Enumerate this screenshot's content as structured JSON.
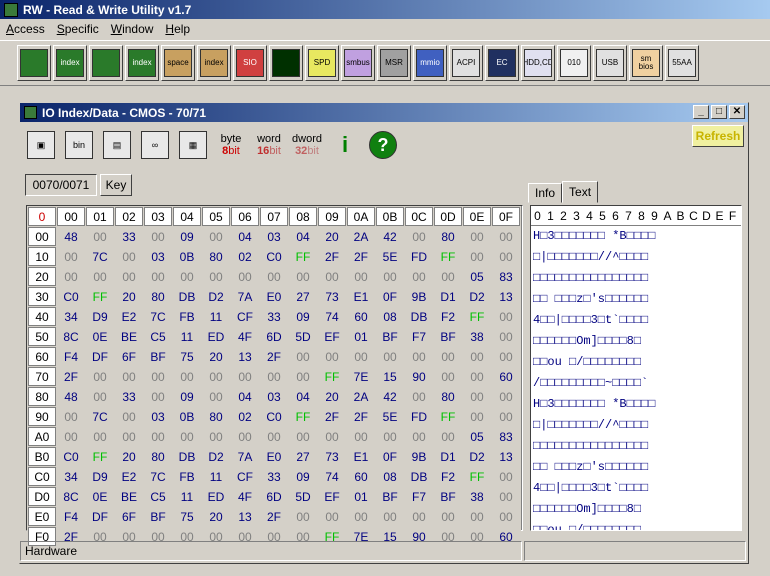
{
  "app": {
    "title": "RW - Read & Write Utility v1.7"
  },
  "menu": [
    {
      "label": "Access",
      "key": "A"
    },
    {
      "label": "Specific",
      "key": "S"
    },
    {
      "label": "Window",
      "key": "W"
    },
    {
      "label": "Help",
      "key": "H"
    }
  ],
  "toolbar": [
    {
      "name": "pci-icon",
      "label": ""
    },
    {
      "name": "pci-index-icon",
      "label": "index"
    },
    {
      "name": "memory-icon",
      "label": ""
    },
    {
      "name": "memory-index-icon",
      "label": "index"
    },
    {
      "name": "io-space-icon",
      "label": "space"
    },
    {
      "name": "io-index-icon",
      "label": "index"
    },
    {
      "name": "sio-icon",
      "label": "SIO"
    },
    {
      "name": "oscilloscope-icon",
      "label": ""
    },
    {
      "name": "spd-icon",
      "label": "SPD"
    },
    {
      "name": "smbus-icon",
      "label": "smbus"
    },
    {
      "name": "msr-icon",
      "label": "MSR"
    },
    {
      "name": "mmio-icon",
      "label": "mmio"
    },
    {
      "name": "acpi-icon",
      "label": "ACPI"
    },
    {
      "name": "ec-icon",
      "label": "EC"
    },
    {
      "name": "hdd-cd-icon",
      "label": "HDD,CD"
    },
    {
      "name": "ata-icon",
      "label": "010"
    },
    {
      "name": "usb-icon",
      "label": "USB"
    },
    {
      "name": "smbios-icon",
      "label": "sm bios"
    },
    {
      "name": "55aa-icon",
      "label": "55AA"
    }
  ],
  "child": {
    "title": "IO Index/Data - CMOS - 70/71",
    "refresh_label": "Refresh",
    "address": "0070/0071",
    "key_label": "Key",
    "bit_byte": "byte",
    "bit_byte_n": "8",
    "bit_byte_u": "bit",
    "bit_word": "word",
    "bit_word_n": "16",
    "bit_word_u": "bit",
    "bit_dword": "dword",
    "bit_dword_n": "32",
    "bit_dword_u": "bit",
    "tabs": [
      "Info",
      "Text"
    ],
    "status_left": "Hardware",
    "status_right": ""
  },
  "hex": {
    "corner": "0",
    "columns": [
      "00",
      "01",
      "02",
      "03",
      "04",
      "05",
      "06",
      "07",
      "08",
      "09",
      "0A",
      "0B",
      "0C",
      "0D",
      "0E",
      "0F"
    ],
    "rows": [
      {
        "addr": "00",
        "vals": [
          "48",
          "00",
          "33",
          "00",
          "09",
          "00",
          "04",
          "03",
          "04",
          "20",
          "2A",
          "42",
          "00",
          "80",
          "00",
          "00"
        ]
      },
      {
        "addr": "10",
        "vals": [
          "00",
          "7C",
          "00",
          "03",
          "0B",
          "80",
          "02",
          "C0",
          "FF",
          "2F",
          "2F",
          "5E",
          "FD",
          "FF",
          "00",
          "00"
        ]
      },
      {
        "addr": "20",
        "vals": [
          "00",
          "00",
          "00",
          "00",
          "00",
          "00",
          "00",
          "00",
          "00",
          "00",
          "00",
          "00",
          "00",
          "00",
          "05",
          "83"
        ]
      },
      {
        "addr": "30",
        "vals": [
          "C0",
          "FF",
          "20",
          "80",
          "DB",
          "D2",
          "7A",
          "E0",
          "27",
          "73",
          "E1",
          "0F",
          "9B",
          "D1",
          "D2",
          "13"
        ]
      },
      {
        "addr": "40",
        "vals": [
          "34",
          "D9",
          "E2",
          "7C",
          "FB",
          "11",
          "CF",
          "33",
          "09",
          "74",
          "60",
          "08",
          "DB",
          "F2",
          "FF",
          "00"
        ]
      },
      {
        "addr": "50",
        "vals": [
          "8C",
          "0E",
          "BE",
          "C5",
          "11",
          "ED",
          "4F",
          "6D",
          "5D",
          "EF",
          "01",
          "BF",
          "F7",
          "BF",
          "38",
          "00"
        ]
      },
      {
        "addr": "60",
        "vals": [
          "F4",
          "DF",
          "6F",
          "BF",
          "75",
          "20",
          "13",
          "2F",
          "00",
          "00",
          "00",
          "00",
          "00",
          "00",
          "00",
          "00"
        ]
      },
      {
        "addr": "70",
        "vals": [
          "2F",
          "00",
          "00",
          "00",
          "00",
          "00",
          "00",
          "00",
          "00",
          "FF",
          "7E",
          "15",
          "90",
          "00",
          "00",
          "60"
        ]
      },
      {
        "addr": "80",
        "vals": [
          "48",
          "00",
          "33",
          "00",
          "09",
          "00",
          "04",
          "03",
          "04",
          "20",
          "2A",
          "42",
          "00",
          "80",
          "00",
          "00"
        ]
      },
      {
        "addr": "90",
        "vals": [
          "00",
          "7C",
          "00",
          "03",
          "0B",
          "80",
          "02",
          "C0",
          "FF",
          "2F",
          "2F",
          "5E",
          "FD",
          "FF",
          "00",
          "00"
        ]
      },
      {
        "addr": "A0",
        "vals": [
          "00",
          "00",
          "00",
          "00",
          "00",
          "00",
          "00",
          "00",
          "00",
          "00",
          "00",
          "00",
          "00",
          "00",
          "05",
          "83"
        ]
      },
      {
        "addr": "B0",
        "vals": [
          "C0",
          "FF",
          "20",
          "80",
          "DB",
          "D2",
          "7A",
          "E0",
          "27",
          "73",
          "E1",
          "0F",
          "9B",
          "D1",
          "D2",
          "13"
        ]
      },
      {
        "addr": "C0",
        "vals": [
          "34",
          "D9",
          "E2",
          "7C",
          "FB",
          "11",
          "CF",
          "33",
          "09",
          "74",
          "60",
          "08",
          "DB",
          "F2",
          "FF",
          "00"
        ]
      },
      {
        "addr": "D0",
        "vals": [
          "8C",
          "0E",
          "BE",
          "C5",
          "11",
          "ED",
          "4F",
          "6D",
          "5D",
          "EF",
          "01",
          "BF",
          "F7",
          "BF",
          "38",
          "00"
        ]
      },
      {
        "addr": "E0",
        "vals": [
          "F4",
          "DF",
          "6F",
          "BF",
          "75",
          "20",
          "13",
          "2F",
          "00",
          "00",
          "00",
          "00",
          "00",
          "00",
          "00",
          "00"
        ]
      },
      {
        "addr": "F0",
        "vals": [
          "2F",
          "00",
          "00",
          "00",
          "00",
          "00",
          "00",
          "00",
          "00",
          "FF",
          "7E",
          "15",
          "90",
          "00",
          "00",
          "60"
        ]
      }
    ]
  },
  "text": {
    "header": [
      "0",
      "1",
      "2",
      "3",
      "4",
      "5",
      "6",
      "7",
      "8",
      "9",
      "A",
      "B",
      "C",
      "D",
      "E",
      "F"
    ],
    "rows": [
      "H□3□□□□□□□ *B□□□□",
      "□|□□□□□□□//^□□□□",
      "□□□□□□□□□□□□□□□□",
      "□□ □□□z□'s□□□□□□",
      "4□□|□□□□3□t`□□□□",
      "□□□□□□Om]□□□□8□",
      "□□ou □/□□□□□□□□",
      "/□□□□□□□□□~□□□□`",
      "H□3□□□□□□□ *B□□□□",
      "□|□□□□□□□//^□□□□",
      "□□□□□□□□□□□□□□□□",
      "□□ □□□z□'s□□□□□□",
      "4□□|□□□□3□t`□□□□",
      "□□□□□□Om]□□□□8□",
      "□□ou □/□□□□□□□□",
      "/□□□□□□□□□~□□□□`"
    ]
  },
  "colors": {
    "title_from": "#0a246a",
    "title_to": "#a6caf0",
    "value_dark": "#000080",
    "value_zero": "#808080",
    "value_ff": "#00c000",
    "corner": "#cc0000"
  }
}
